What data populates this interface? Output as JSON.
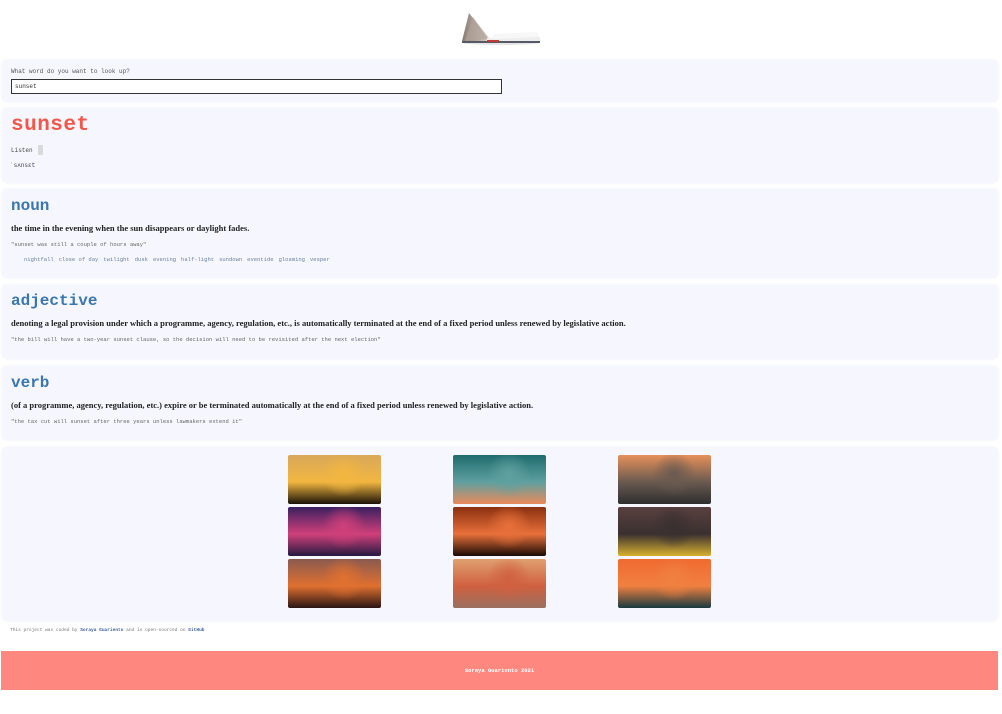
{
  "logo": {
    "icon": "open-book-icon"
  },
  "search": {
    "label": "What word do you want to look up?",
    "value": "sunset"
  },
  "word": {
    "title": "sunset",
    "listen_label": "Listen",
    "phonetic": "ˈsʌnsɛt"
  },
  "meanings": [
    {
      "part_of_speech": "noun",
      "definition": "the time in the evening when the sun disappears or daylight fades.",
      "example": "\"sunset was still a couple of hours away\"",
      "synonyms": [
        "nightfall",
        "close of day",
        "twilight",
        "dusk",
        "evening",
        "half-light",
        "sundown",
        "eventide",
        "gloaming",
        "vesper"
      ]
    },
    {
      "part_of_speech": "adjective",
      "definition": "denoting a legal provision under which a programme, agency, regulation, etc., is automatically terminated at the end of a fixed period unless renewed by legislative action.",
      "example": "\"the bill will have a two-year sunset clause, so the decision will need to be revisited after the next election\""
    },
    {
      "part_of_speech": "verb",
      "definition": "(of a programme, agency, regulation, etc.) expire or be terminated automatically at the end of a fixed period unless renewed by legislative action.",
      "example": "\"the tax cut will sunset after three years unless lawmakers extend it\""
    }
  ],
  "photos": [
    {
      "alt": "silhouette couple on hill at sunset",
      "colors": [
        "#d9a85a",
        "#f2b640",
        "#1a1208"
      ]
    },
    {
      "alt": "teal and orange sky streaks",
      "colors": [
        "#1f6b6e",
        "#5fa0a0",
        "#e98a5a"
      ]
    },
    {
      "alt": "sun over ocean waves",
      "colors": [
        "#e7905a",
        "#6a5a50",
        "#2e2e30"
      ]
    },
    {
      "alt": "tree silhouette under purple sky",
      "colors": [
        "#3a2060",
        "#d0407a",
        "#251a40"
      ]
    },
    {
      "alt": "sun with tree silhouette",
      "colors": [
        "#8a3010",
        "#e8703a",
        "#1a0a05"
      ]
    },
    {
      "alt": "road with palm trees at sunset",
      "colors": [
        "#5a4040",
        "#3a3030",
        "#d8b030"
      ]
    },
    {
      "alt": "sunset over sea with clouds",
      "colors": [
        "#8a5a50",
        "#e07030",
        "#2a1515"
      ]
    },
    {
      "alt": "blurred sunset on beach",
      "colors": [
        "#e0a070",
        "#d06040",
        "#9a7060"
      ]
    },
    {
      "alt": "orange sky over dark sea",
      "colors": [
        "#f06a30",
        "#f08040",
        "#1a3a40"
      ]
    }
  ],
  "credit": {
    "prefix": "This project was coded by",
    "author": "Soraya Guariento",
    "middle": "and is open-sourced on",
    "repo": "GitHub"
  },
  "footer": {
    "text": "Soraya Guariento 2021"
  },
  "colors": {
    "word_title": "#f4574a",
    "pos_heading": "#3a76b0",
    "section_bg": "#f6f7fe",
    "footer_bg": "#fe8880"
  }
}
